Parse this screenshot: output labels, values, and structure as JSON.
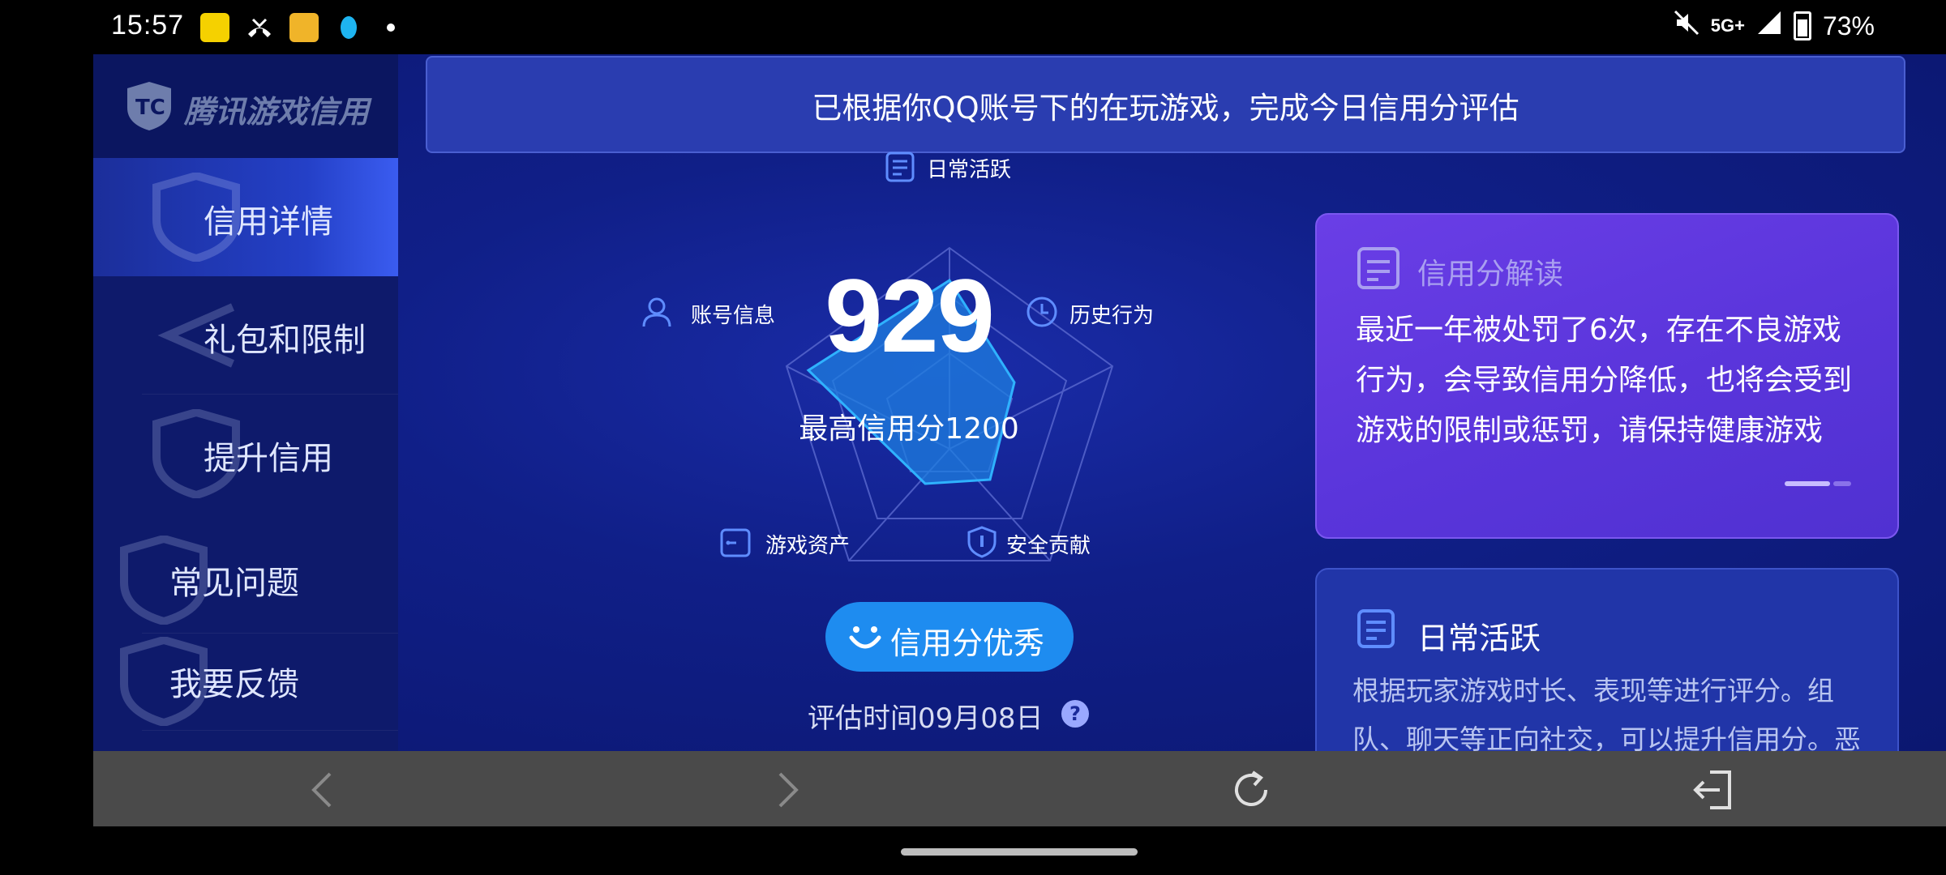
{
  "status_bar": {
    "time": "15:57",
    "battery": "73%",
    "network": "5G+"
  },
  "sidebar": {
    "logo_text": "腾讯游戏信用",
    "items": [
      {
        "label": "信用详情",
        "active": true
      },
      {
        "label": "礼包和限制",
        "active": false
      },
      {
        "label": "提升信用",
        "active": false
      },
      {
        "label": "常见问题",
        "active": false
      },
      {
        "label": "我要反馈",
        "active": false
      }
    ]
  },
  "banner": {
    "text": "已根据你QQ账号下的在玩游戏，完成今日信用分评估"
  },
  "score": {
    "value": "929",
    "max_label": "最高信用分1200"
  },
  "dimensions": [
    {
      "label": "日常活跃",
      "icon": "document-icon"
    },
    {
      "label": "历史行为",
      "icon": "clock-icon"
    },
    {
      "label": "安全贡献",
      "icon": "shield-icon"
    },
    {
      "label": "游戏资产",
      "icon": "wallet-icon"
    },
    {
      "label": "账号信息",
      "icon": "user-icon"
    }
  ],
  "rating": {
    "label": "信用分优秀"
  },
  "evaluation": {
    "label": "评估时间09月08日",
    "help": "?"
  },
  "interpretation": {
    "title": "信用分解读",
    "body": "最近一年被处罚了6次，存在不良游戏行为，会导致信用分降低，也将会受到游戏的限制或惩罚，请保持健康游戏"
  },
  "daily_activity": {
    "title": "日常活跃",
    "body": "根据玩家游戏时长、表现等进行评分。组队、聊天等正向社交，可以提升信用分。恶"
  },
  "colors": {
    "accent": "#1e8cf0",
    "card_purple": "#5a35db",
    "background": "#0c1868"
  }
}
